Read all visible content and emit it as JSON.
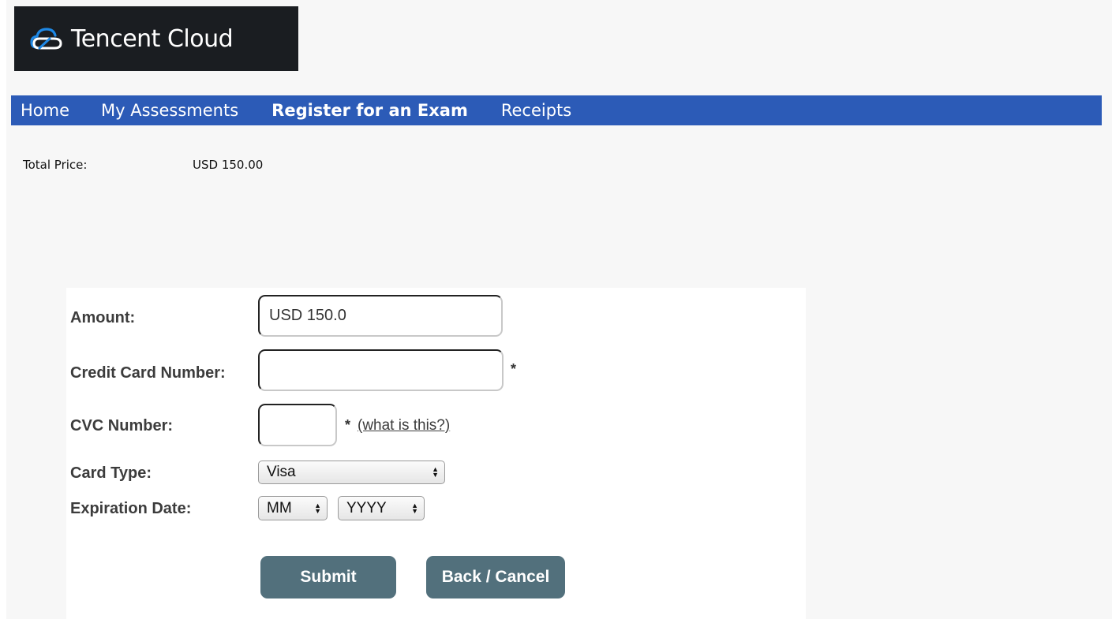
{
  "brand": {
    "name": "Tencent Cloud",
    "logo_icon": "cloud-icon",
    "colors": {
      "logo_bg": "#1a1d21",
      "logo_icon_blue": "#1e88e5"
    }
  },
  "nav": {
    "color": "#2c5bb7",
    "items": [
      {
        "label": "Home",
        "active": false
      },
      {
        "label": "My Assessments",
        "active": false
      },
      {
        "label": "Register for an Exam",
        "active": true
      },
      {
        "label": "Receipts",
        "active": false
      }
    ]
  },
  "summary": {
    "total_price_label": "Total Price:",
    "total_price_value": "USD 150.00"
  },
  "form": {
    "amount": {
      "label": "Amount:",
      "value": "USD 150.0"
    },
    "card_number": {
      "label": "Credit Card Number:",
      "value": "",
      "required_mark": "*"
    },
    "cvc": {
      "label": "CVC Number:",
      "value": "",
      "required_mark": "*",
      "help_link": "(what is this?)"
    },
    "card_type": {
      "label": "Card Type:",
      "selected": "Visa"
    },
    "expiration": {
      "label": "Expiration Date:",
      "month_selected": "MM",
      "year_selected": "YYYY"
    },
    "buttons": {
      "submit": "Submit",
      "cancel": "Back / Cancel",
      "color": "#52707c"
    }
  }
}
